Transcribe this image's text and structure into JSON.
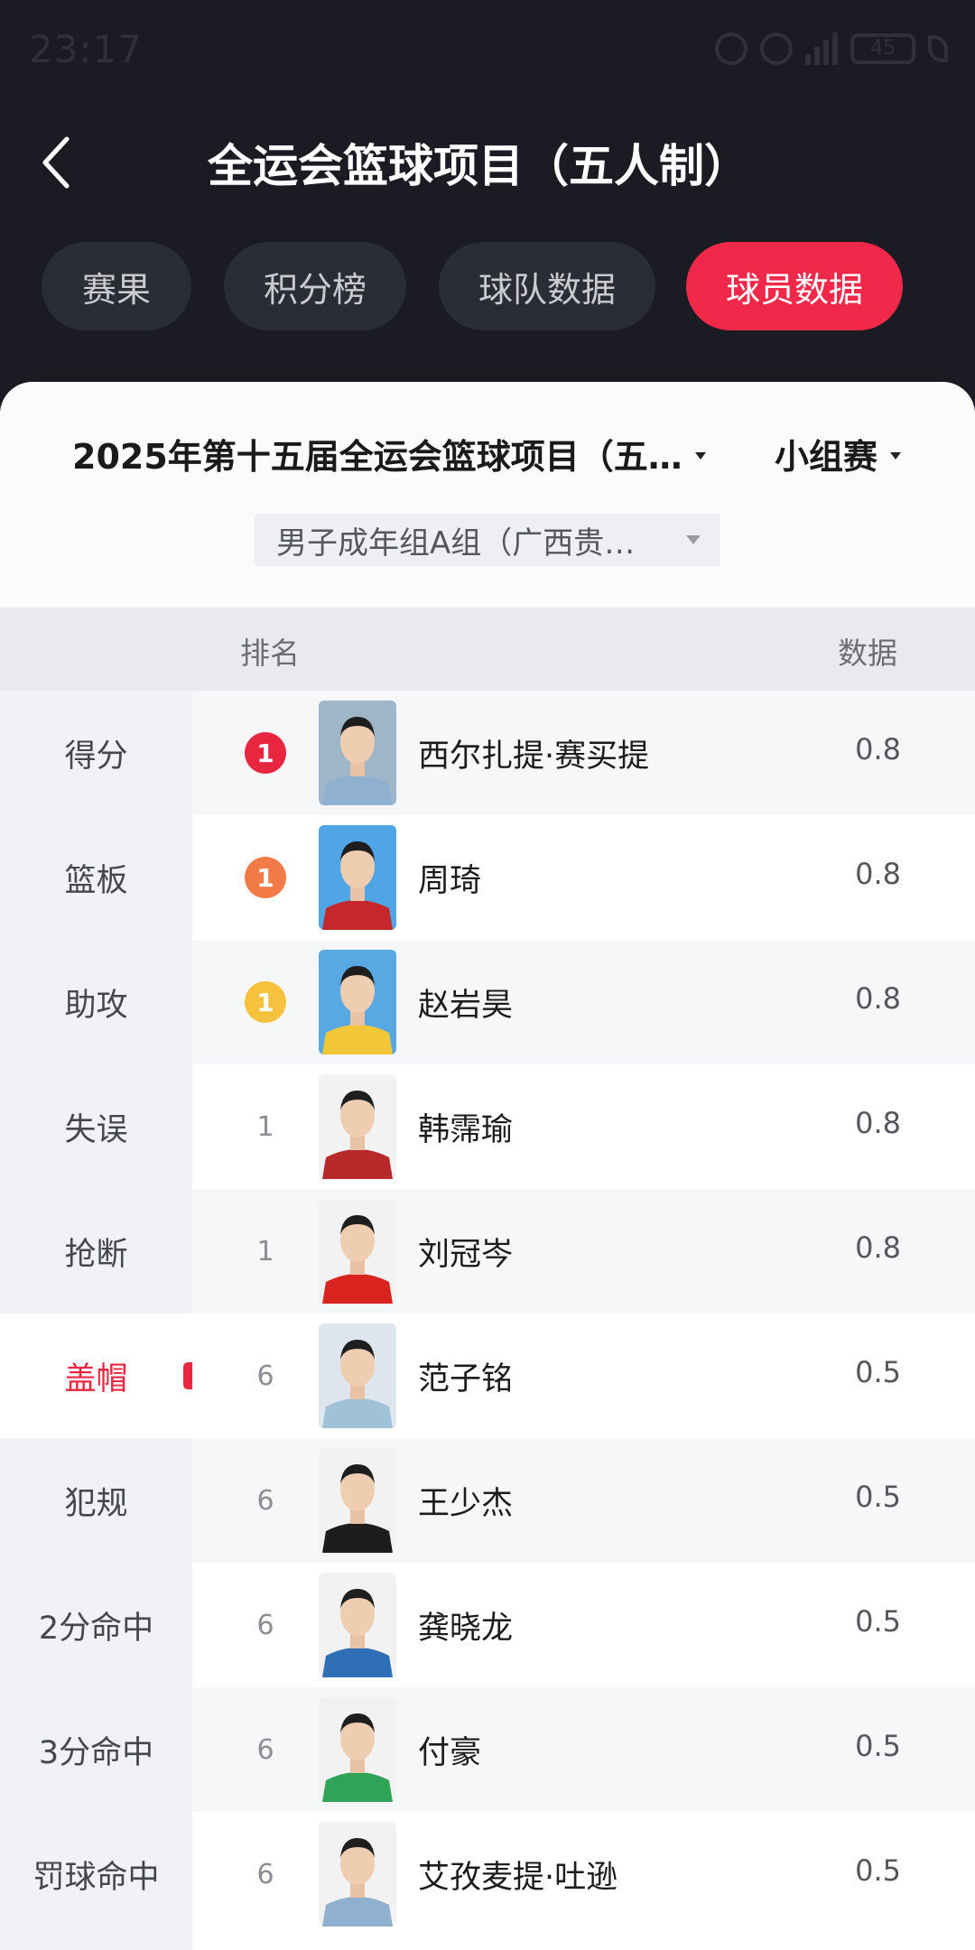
{
  "status_bar": {
    "time": "23:17",
    "battery": "45",
    "network": "4G"
  },
  "header": {
    "title": "全运会篮球项目（五人制）",
    "back_icon": "chevron-left-icon"
  },
  "tabs": [
    {
      "label": "赛果",
      "active": false
    },
    {
      "label": "积分榜",
      "active": false
    },
    {
      "label": "球队数据",
      "active": false
    },
    {
      "label": "球员数据",
      "active": true
    }
  ],
  "filters": {
    "season": "2025年第十五届全运会篮球项目（五…",
    "stage": "小组赛",
    "group": "男子成年组A组（广西贵…"
  },
  "table_header": {
    "rank": "排名",
    "value": "数据"
  },
  "categories": [
    {
      "label": "得分",
      "active": false
    },
    {
      "label": "篮板",
      "active": false
    },
    {
      "label": "助攻",
      "active": false
    },
    {
      "label": "失误",
      "active": false
    },
    {
      "label": "抢断",
      "active": false
    },
    {
      "label": "盖帽",
      "active": true
    },
    {
      "label": "犯规",
      "active": false
    },
    {
      "label": "2分命中",
      "active": false
    },
    {
      "label": "3分命中",
      "active": false
    },
    {
      "label": "罚球命中",
      "active": false
    }
  ],
  "players": [
    {
      "rank": "1",
      "name": "西尔扎提·赛买提",
      "value": "0.8",
      "badge_color": "#e8263f",
      "bg": "#9fb6c9",
      "jersey": "#8fb1cf"
    },
    {
      "rank": "1",
      "name": "周琦",
      "value": "0.8",
      "badge_color": "#f27a47",
      "bg": "#4fa5e6",
      "jersey": "#c5282c"
    },
    {
      "rank": "1",
      "name": "赵岩昊",
      "value": "0.8",
      "badge_color": "#f6c13d",
      "bg": "#58a9e3",
      "jersey": "#f1c637"
    },
    {
      "rank": "1",
      "name": "韩霈瑜",
      "value": "0.8",
      "badge_color": "",
      "bg": "#f2f2f2",
      "jersey": "#b72a2c"
    },
    {
      "rank": "1",
      "name": "刘冠岑",
      "value": "0.8",
      "badge_color": "",
      "bg": "#f2f2f2",
      "jersey": "#d8231f"
    },
    {
      "rank": "6",
      "name": "范子铭",
      "value": "0.5",
      "badge_color": "",
      "bg": "#dfe5ee",
      "jersey": "#9fc2d6"
    },
    {
      "rank": "6",
      "name": "王少杰",
      "value": "0.5",
      "badge_color": "",
      "bg": "#f2f2f2",
      "jersey": "#1d1d1d"
    },
    {
      "rank": "6",
      "name": "龚晓龙",
      "value": "0.5",
      "badge_color": "",
      "bg": "#f2f2f2",
      "jersey": "#2f6fb6"
    },
    {
      "rank": "6",
      "name": "付豪",
      "value": "0.5",
      "badge_color": "",
      "bg": "#f2f2f2",
      "jersey": "#2fa357"
    },
    {
      "rank": "6",
      "name": "艾孜麦提·吐逊",
      "value": "0.5",
      "badge_color": "",
      "bg": "#f2f2f2",
      "jersey": "#8fb1cf"
    }
  ],
  "colors": {
    "accent": "#f2284a",
    "header_bg": "#1b1c23"
  }
}
